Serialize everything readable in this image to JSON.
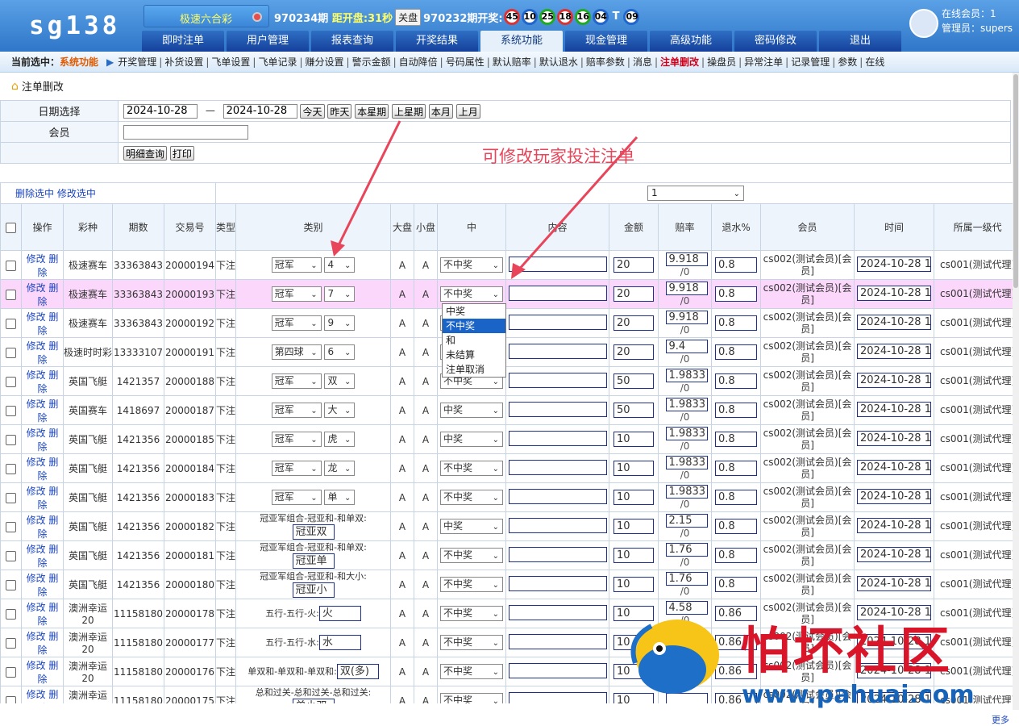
{
  "header": {
    "logo": "sg138",
    "game": "极速六合彩",
    "period": "970234期",
    "countdown_label": "距开盘:",
    "countdown": "31秒",
    "close_btn": "关盘",
    "last_period": "970232期开奖:",
    "balls": [
      "45",
      "10",
      "25",
      "18",
      "16",
      "04",
      "T",
      "09"
    ],
    "ball_colors": [
      "r",
      "b",
      "g",
      "r",
      "g",
      "b",
      "t",
      "b"
    ]
  },
  "nav": {
    "tabs": [
      "即时注单",
      "用户管理",
      "报表查询",
      "开奖结果",
      "系统功能",
      "现金管理",
      "高级功能",
      "密码修改",
      "退出"
    ],
    "active": 4
  },
  "user": {
    "online_label": "在线会员：1",
    "admin_label": "管理员：supers"
  },
  "subnav": {
    "current_label": "当前选中：",
    "current_section": "系统功能",
    "links": [
      "开奖管理",
      "补货设置",
      "飞单设置",
      "飞单记录",
      "赚分设置",
      "警示金额",
      "自动降倍",
      "号码属性",
      "默认赔率",
      "默认退水",
      "赔率参数",
      "消息",
      "注单删改",
      "操盘员",
      "异常注单",
      "记录管理",
      "参数",
      "在线"
    ],
    "active": 12
  },
  "page": {
    "title": "注单删改",
    "annotation": "可修改玩家投注注单",
    "more": "更多"
  },
  "filter": {
    "date_label": "日期选择",
    "date_from": "2024-10-28",
    "dash": "—",
    "date_to": "2024-10-28",
    "quick": [
      "今天",
      "昨天",
      "本星期",
      "上星期",
      "本月",
      "上月"
    ],
    "member_label": "会员",
    "member_value": "",
    "detail_btn": "明细查询",
    "print_btn": "打印"
  },
  "actions": {
    "delete_selected": "删除选中",
    "edit_selected": "修改选中",
    "page_value": "1"
  },
  "columns": [
    "操作",
    "彩种",
    "期数",
    "交易号",
    "类型",
    "类别",
    "大盘",
    "小盘",
    "中",
    "内容",
    "金额",
    "赔率",
    "退水%",
    "会员",
    "时间",
    "所属一级代"
  ],
  "row_ops": {
    "edit": "修改",
    "del": "删除"
  },
  "rows": [
    {
      "game": "极速赛车",
      "period": "33363843",
      "trade": "20000194",
      "type": "下注",
      "cat1": "冠军",
      "cat2": "4",
      "big": "A",
      "small": "A",
      "result": "不中奖",
      "content": "",
      "amount": "20",
      "odds": "9.918",
      "odds_sub": "/0",
      "rebate": "0.8",
      "member": "cs002(测试会员)[会员]",
      "time": "2024-10-28 14",
      "agent": "cs001(测试代理)"
    },
    {
      "game": "极速赛车",
      "period": "33363843",
      "trade": "20000193",
      "type": "下注",
      "cat1": "冠军",
      "cat2": "7",
      "big": "A",
      "small": "A",
      "result": "不中奖",
      "content": "",
      "amount": "20",
      "odds": "9.918",
      "odds_sub": "/0",
      "rebate": "0.8",
      "member": "cs002(测试会员)[会员]",
      "time": "2024-10-28 14",
      "agent": "cs001(测试代理)"
    },
    {
      "game": "极速赛车",
      "period": "33363843",
      "trade": "20000192",
      "type": "下注",
      "cat1": "冠军",
      "cat2": "9",
      "big": "A",
      "small": "A",
      "result": "",
      "content": "",
      "amount": "20",
      "odds": "9.918",
      "odds_sub": "/0",
      "rebate": "0.8",
      "member": "cs002(测试会员)[会员]",
      "time": "2024-10-28 14",
      "agent": "cs001(测试代理)"
    },
    {
      "game": "极速时时彩",
      "period": "13333107",
      "trade": "20000191",
      "type": "下注",
      "cat1": "第四球",
      "cat2": "6",
      "big": "A",
      "small": "A",
      "result": "",
      "content": "",
      "amount": "20",
      "odds": "9.4",
      "odds_sub": "/0",
      "rebate": "0.8",
      "member": "cs002(测试会员)[会员]",
      "time": "2024-10-28 14",
      "agent": "cs001(测试代理)"
    },
    {
      "game": "英国飞艇",
      "period": "1421357",
      "trade": "20000188",
      "type": "下注",
      "cat1": "冠军",
      "cat2": "双",
      "big": "A",
      "small": "A",
      "result": "不中奖",
      "content": "",
      "amount": "50",
      "odds": "1.9833",
      "odds_sub": "/0",
      "rebate": "0.8",
      "member": "cs002(测试会员)[会员]",
      "time": "2024-10-28 14",
      "agent": "cs001(测试代理)"
    },
    {
      "game": "英国赛车",
      "period": "1418697",
      "trade": "20000187",
      "type": "下注",
      "cat1": "冠军",
      "cat2": "大",
      "big": "A",
      "small": "A",
      "result": "中奖",
      "content": "",
      "amount": "50",
      "odds": "1.9833",
      "odds_sub": "/0",
      "rebate": "0.8",
      "member": "cs002(测试会员)[会员]",
      "time": "2024-10-28 14",
      "agent": "cs001(测试代理)"
    },
    {
      "game": "英国飞艇",
      "period": "1421356",
      "trade": "20000185",
      "type": "下注",
      "cat1": "冠军",
      "cat2": "虎",
      "big": "A",
      "small": "A",
      "result": "中奖",
      "content": "",
      "amount": "10",
      "odds": "1.9833",
      "odds_sub": "/0",
      "rebate": "0.8",
      "member": "cs002(测试会员)[会员]",
      "time": "2024-10-28 14",
      "agent": "cs001(测试代理)"
    },
    {
      "game": "英国飞艇",
      "period": "1421356",
      "trade": "20000184",
      "type": "下注",
      "cat1": "冠军",
      "cat2": "龙",
      "big": "A",
      "small": "A",
      "result": "不中奖",
      "content": "",
      "amount": "10",
      "odds": "1.9833",
      "odds_sub": "/0",
      "rebate": "0.8",
      "member": "cs002(测试会员)[会员]",
      "time": "2024-10-28 14",
      "agent": "cs001(测试代理)"
    },
    {
      "game": "英国飞艇",
      "period": "1421356",
      "trade": "20000183",
      "type": "下注",
      "cat1": "冠军",
      "cat2": "单",
      "big": "A",
      "small": "A",
      "result": "不中奖",
      "content": "",
      "amount": "10",
      "odds": "1.9833",
      "odds_sub": "/0",
      "rebate": "0.8",
      "member": "cs002(测试会员)[会员]",
      "time": "2024-10-28 14",
      "agent": "cs001(测试代理)"
    },
    {
      "game": "英国飞艇",
      "period": "1421356",
      "trade": "20000182",
      "type": "下注",
      "catline": "冠亚军组合-冠亚和-和单双:",
      "catbox": "冠亚双",
      "big": "A",
      "small": "A",
      "result": "中奖",
      "content": "",
      "amount": "10",
      "odds": "2.15",
      "odds_sub": "/0",
      "rebate": "0.8",
      "member": "cs002(测试会员)[会员]",
      "time": "2024-10-28 14",
      "agent": "cs001(测试代理)"
    },
    {
      "game": "英国飞艇",
      "period": "1421356",
      "trade": "20000181",
      "type": "下注",
      "catline": "冠亚军组合-冠亚和-和单双:",
      "catbox": "冠亚单",
      "big": "A",
      "small": "A",
      "result": "不中奖",
      "content": "",
      "amount": "10",
      "odds": "1.76",
      "odds_sub": "/0",
      "rebate": "0.8",
      "member": "cs002(测试会员)[会员]",
      "time": "2024-10-28 14",
      "agent": "cs001(测试代理)"
    },
    {
      "game": "英国飞艇",
      "period": "1421356",
      "trade": "20000180",
      "type": "下注",
      "catline": "冠亚军组合-冠亚和-和大小:",
      "catbox": "冠亚小",
      "big": "A",
      "small": "A",
      "result": "不中奖",
      "content": "",
      "amount": "10",
      "odds": "1.76",
      "odds_sub": "/0",
      "rebate": "0.8",
      "member": "cs002(测试会员)[会员]",
      "time": "2024-10-28 14",
      "agent": "cs001(测试代理)"
    },
    {
      "game": "澳洲幸运20",
      "period": "11158180",
      "trade": "20000178",
      "type": "下注",
      "catinline": "五行-五行-火:",
      "catbox": "火",
      "big": "A",
      "small": "A",
      "result": "不中奖",
      "content": "",
      "amount": "10",
      "odds": "4.58",
      "odds_sub": "/0",
      "rebate": "0.86",
      "member": "cs002(测试会员)[会员]",
      "time": "2024-10-28 14",
      "agent": "cs001(测试代理)"
    },
    {
      "game": "澳洲幸运20",
      "period": "11158180",
      "trade": "20000177",
      "type": "下注",
      "catinline": "五行-五行-水:",
      "catbox": "水",
      "big": "A",
      "small": "A",
      "result": "不中奖",
      "content": "",
      "amount": "10",
      "odds": "",
      "odds_sub": "",
      "rebate": "0.86",
      "member": "cs002(测试会员)[会员]",
      "time": "2024-10-28 14",
      "agent": "cs001(测试代理)"
    },
    {
      "game": "澳洲幸运20",
      "period": "11158180",
      "trade": "20000176",
      "type": "下注",
      "catinline": "单双和-单双和-单双和:",
      "catbox": "双(多)",
      "big": "A",
      "small": "A",
      "result": "不中奖",
      "content": "",
      "amount": "10",
      "odds": "",
      "odds_sub": "",
      "rebate": "0.86",
      "member": "cs002(测试会员)[会员]",
      "time": "2024-10-28 14",
      "agent": "cs001(测试代理)"
    },
    {
      "game": "澳洲幸运20",
      "period": "11158180",
      "trade": "20000175",
      "type": "下注",
      "catline": "总和过关-总和过关-总和过关:",
      "catbox": "单小双",
      "big": "A",
      "small": "A",
      "result": "不中奖",
      "content": "",
      "amount": "10",
      "odds": "",
      "odds_sub": "",
      "rebate": "0.86",
      "member": "cs002(测试会员)[会员]",
      "time": "2024-10-28 14",
      "agent": "cs001(测试代理)"
    }
  ],
  "dropdown_options": [
    "中奖",
    "不中奖",
    "和",
    "未结算",
    "注单取消"
  ],
  "dropdown_selected": 1,
  "watermark": {
    "title": "怕坏社区",
    "url": "www.pahuai.com"
  },
  "colors": {
    "header": "#2f76c9",
    "highlight_row": "#fbd8fb",
    "accent_red": "#d9152a",
    "link": "#1a45c0",
    "annotation": "#e8455a"
  }
}
